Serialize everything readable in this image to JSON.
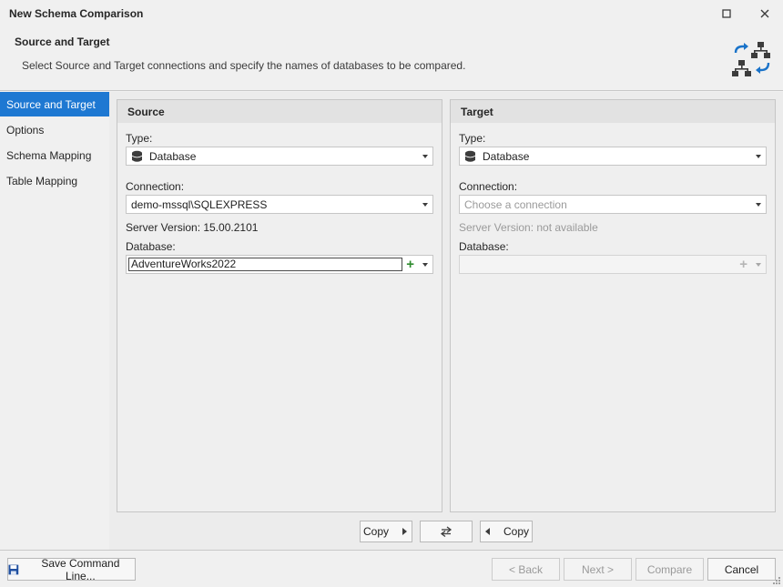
{
  "window": {
    "title": "New Schema Comparison",
    "maximize_icon": "maximize-icon",
    "close_icon": "close-icon"
  },
  "header": {
    "title": "Source and Target",
    "description": "Select Source and Target connections and specify the names of databases to be compared.",
    "icon": "schema-compare-icon"
  },
  "sidebar": {
    "items": [
      {
        "label": "Source and Target",
        "active": true
      },
      {
        "label": "Options",
        "active": false
      },
      {
        "label": "Schema Mapping",
        "active": false
      },
      {
        "label": "Table Mapping",
        "active": false
      }
    ]
  },
  "source": {
    "title": "Source",
    "type_label": "Type:",
    "type_value": "Database",
    "connection_label": "Connection:",
    "connection_value": "demo-mssql\\SQLEXPRESS",
    "server_version": "Server Version: 15.00.2101",
    "database_label": "Database:",
    "database_value": "AdventureWorks2022"
  },
  "target": {
    "title": "Target",
    "type_label": "Type:",
    "type_value": "Database",
    "connection_label": "Connection:",
    "connection_placeholder": "Choose a connection",
    "server_version": "Server Version: not available",
    "database_label": "Database:",
    "database_value": ""
  },
  "copybar": {
    "copy_right_label": "Copy",
    "swap_icon": "swap-arrows-icon",
    "copy_left_label": "Copy"
  },
  "footer": {
    "save_command_line_label": "Save Command Line...",
    "back_label": "< Back",
    "next_label": "Next >",
    "compare_label": "Compare",
    "cancel_label": "Cancel"
  },
  "colors": {
    "accent": "#1e78d2",
    "add_green": "#2e8b2e",
    "icon_blue": "#1a73c9",
    "icon_dark": "#3c3c3c"
  }
}
